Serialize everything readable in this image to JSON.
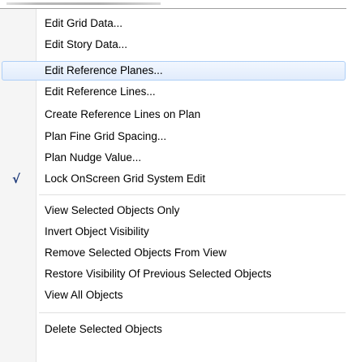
{
  "menu": {
    "group1": [
      {
        "label": "Edit Grid Data..."
      },
      {
        "label": "Edit Story Data..."
      },
      {
        "label": "Edit Reference Planes..."
      },
      {
        "label": "Edit Reference Lines..."
      },
      {
        "label": "Create Reference Lines on Plan"
      },
      {
        "label": "Plan Fine Grid Spacing..."
      },
      {
        "label": "Plan Nudge Value..."
      },
      {
        "label": "Lock OnScreen Grid System Edit",
        "check": "√"
      }
    ],
    "group2": [
      {
        "label": "View Selected Objects Only"
      },
      {
        "label": "Invert Object Visibility"
      },
      {
        "label": "Remove Selected Objects From View"
      },
      {
        "label": "Restore Visibility Of Previous Selected Objects"
      },
      {
        "label": "View All Objects"
      }
    ],
    "group3": [
      {
        "label": "Delete Selected Objects"
      }
    ],
    "highlighted_item": "Edit Reference Planes...",
    "colors": {
      "highlight_border": "#aecff7",
      "highlight_fill": "#e1ecfc",
      "check_mark": "#1d3a7a",
      "gutter": "#f5f5f5"
    }
  }
}
